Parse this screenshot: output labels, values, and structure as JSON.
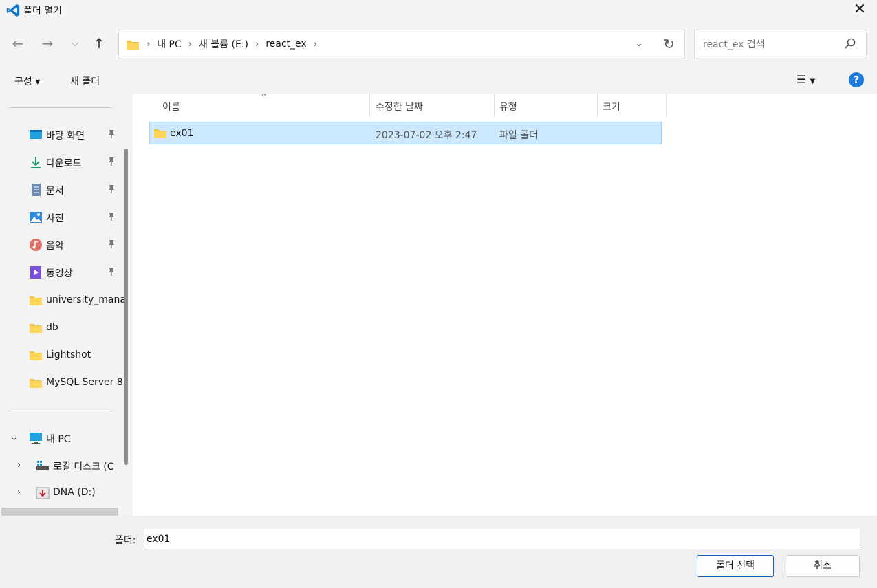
{
  "window": {
    "title": "폴더 열기"
  },
  "nav": {
    "back_icon": "arrow-left-icon",
    "forward_icon": "arrow-right-icon",
    "recent_icon": "chevron-down-icon",
    "up_icon": "arrow-up-icon"
  },
  "address": {
    "crumbs": [
      "내 PC",
      "새 볼륨 (E:)",
      "react_ex"
    ]
  },
  "search": {
    "placeholder": "react_ex 검색"
  },
  "toolbar": {
    "organize_label": "구성 ▾",
    "new_folder_label": "새 폴더",
    "help_label": "?"
  },
  "sidebar": {
    "quick_access": [
      {
        "label": "바탕 화면",
        "icon": "desktop-icon",
        "pinned": true
      },
      {
        "label": "다운로드",
        "icon": "download-icon",
        "pinned": true
      },
      {
        "label": "문서",
        "icon": "document-icon",
        "pinned": true
      },
      {
        "label": "사진",
        "icon": "pictures-icon",
        "pinned": true
      },
      {
        "label": "음악",
        "icon": "music-icon",
        "pinned": true
      },
      {
        "label": "동영상",
        "icon": "video-icon",
        "pinned": true
      },
      {
        "label": "university_mana",
        "icon": "folder-icon",
        "pinned": false
      },
      {
        "label": "db",
        "icon": "folder-icon",
        "pinned": false
      },
      {
        "label": "Lightshot",
        "icon": "folder-icon",
        "pinned": false
      },
      {
        "label": "MySQL Server 8",
        "icon": "folder-icon",
        "pinned": false
      }
    ],
    "tree": [
      {
        "label": "내 PC",
        "icon": "pc-icon",
        "expanded": true
      },
      {
        "label": "로컬 디스크 (C",
        "icon": "drive-icon",
        "expanded": false
      },
      {
        "label": "DNA (D:)",
        "icon": "usb-drive-icon",
        "expanded": false
      }
    ]
  },
  "columns": {
    "name": "이름",
    "modified": "수정한 날짜",
    "type": "유형",
    "size": "크기"
  },
  "files": [
    {
      "name": "ex01",
      "modified": "2023-07-02 오후 2:47",
      "type": "파일 폴더",
      "size": "",
      "selected": true
    }
  ],
  "footer": {
    "folder_label": "폴더:",
    "folder_value": "ex01",
    "select_label": "폴더 선택",
    "cancel_label": "취소"
  },
  "colors": {
    "accent": "#1e7be0",
    "selection_bg": "#cce8ff",
    "selection_border": "#99d1ff",
    "folder": "#f5c542"
  }
}
